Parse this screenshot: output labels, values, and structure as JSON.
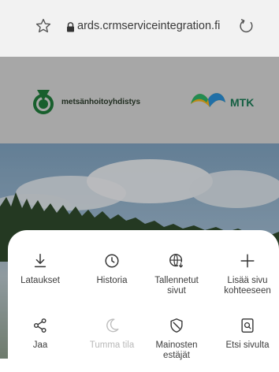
{
  "browser": {
    "url": "ards.crmserviceintegration.fi",
    "icons": {
      "bookmark": "star-icon",
      "secure": "lock-icon",
      "reload": "reload-icon"
    }
  },
  "page": {
    "logo_left_text": "metsänhoitoyhdistys",
    "logo_right_text": "MTK"
  },
  "menu": {
    "items": [
      {
        "label": "Lataukset",
        "icon": "download-icon",
        "enabled": true
      },
      {
        "label": "Historia",
        "icon": "history-clock-icon",
        "enabled": true
      },
      {
        "label": "Tallennetut sivut",
        "icon": "saved-pages-globe-icon",
        "enabled": true
      },
      {
        "label": "Lisää sivu kohteeseen",
        "icon": "plus-icon",
        "enabled": true
      },
      {
        "label": "Jaa",
        "icon": "share-icon",
        "enabled": true
      },
      {
        "label": "Tumma tila",
        "icon": "moon-icon",
        "enabled": false
      },
      {
        "label": "Mainosten estäjät",
        "icon": "ad-block-shield-icon",
        "enabled": true
      },
      {
        "label": "Etsi sivulta",
        "icon": "find-on-page-icon",
        "enabled": true
      }
    ]
  },
  "colors": {
    "mtk_green": "#1a7a55",
    "disabled_text": "#b8b8b8"
  }
}
